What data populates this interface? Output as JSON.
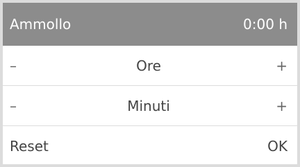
{
  "header": {
    "title": "Ammollo",
    "value": "0:00 h"
  },
  "hours_row": {
    "minus": "–",
    "label": "Ore",
    "plus": "+"
  },
  "minutes_row": {
    "minus": "–",
    "label": "Minuti",
    "plus": "+"
  },
  "actions": {
    "reset_label": "Reset",
    "ok_label": "OK"
  },
  "colors": {
    "header_bg": "#8c8c8c",
    "header_text": "#ffffff",
    "divider": "#dcdcdc"
  }
}
